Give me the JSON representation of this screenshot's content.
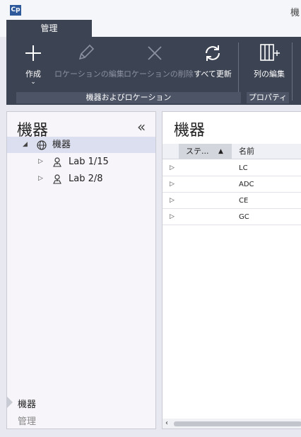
{
  "app": {
    "logo_text": "Cp",
    "window_title": "機"
  },
  "tabs": [
    {
      "label": "管理"
    }
  ],
  "ribbon": {
    "buttons": [
      {
        "label": "作成",
        "icon": "plus-icon",
        "has_dropdown": true,
        "enabled": true
      },
      {
        "label": "ロケーションの編集",
        "icon": "pencil-icon",
        "enabled": false
      },
      {
        "label": "ロケーションの削除",
        "icon": "x-icon",
        "enabled": false
      },
      {
        "label": "すべて更新",
        "icon": "refresh-icon",
        "enabled": true
      },
      {
        "label": "列の編集",
        "icon": "columns-icon",
        "enabled": true
      }
    ],
    "groups": [
      {
        "label": "機器およびロケーション"
      },
      {
        "label": "プロパティ"
      }
    ]
  },
  "left_panel": {
    "title": "機器",
    "collapse_glyph": "«",
    "tree": [
      {
        "label": "機器",
        "icon": "globe-icon",
        "expanded": true,
        "selected": true
      },
      {
        "label": "Lab 1/15",
        "icon": "location-person-icon",
        "expanded": false
      },
      {
        "label": "Lab 2/8",
        "icon": "location-person-icon",
        "expanded": false
      }
    ],
    "nav": [
      {
        "label": "機器",
        "active": true
      },
      {
        "label": "管理",
        "active": false
      }
    ]
  },
  "right_panel": {
    "title": "機器",
    "columns": [
      {
        "label": "ステ...",
        "sorted": "ascending"
      },
      {
        "label": "名前"
      }
    ],
    "rows": [
      {
        "status": "",
        "name": "LC"
      },
      {
        "status": "",
        "name": "ADC"
      },
      {
        "status": "",
        "name": "CE"
      },
      {
        "status": "",
        "name": "GC"
      }
    ]
  },
  "colors": {
    "ribbon_bg": "#3c4352",
    "selection": "#dcdff0",
    "disabled_text": "#8b91a0"
  }
}
